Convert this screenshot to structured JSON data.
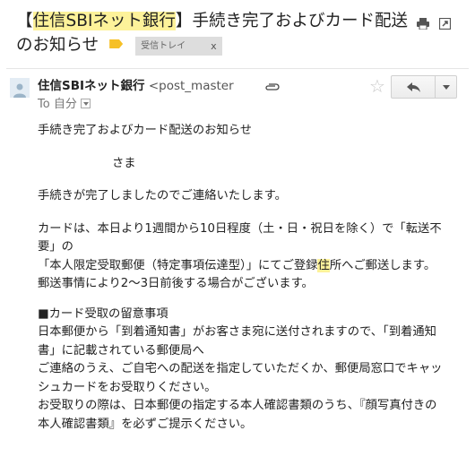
{
  "subject": {
    "open_bracket": "【",
    "bank_name": "住信SBIネット銀行",
    "close_bracket": "】",
    "line1_rest": "手続き完了およびカード配送",
    "line2": "のお知らせ",
    "label_text": "受信トレイ",
    "label_remove": "x"
  },
  "header": {
    "sender_name": "住信SBIネット銀行",
    "sender_email": "<post_master",
    "to_prefix": "To",
    "to_value": "自分",
    "star": "☆"
  },
  "body": {
    "line_title": "手続き完了およびカード配送のお知らせ",
    "line_sama": "さま",
    "line_complete": "手続きが完了しましたのでご連絡いたします。",
    "p2_a": "カードは、本日より1週間から10日程度（土・日・祝日を除く）で「転送不要」の",
    "p2_b1": "「本人限定受取郵便（特定事項伝達型）」にてご登録",
    "p2_b_hl": "住",
    "p2_b2": "所へご郵送します。",
    "p2_c": "郵送事情により2〜3日前後する場合がございます。",
    "section_title": "■カード受取の留意事項",
    "s1": "日本郵便から「到着通知書」がお客さま宛に送付されますので、「到着通知書」に記載されている郵便局へ",
    "s2": "ご連絡のうえ、ご自宅への配送を指定していただくか、郵便局窓口でキャッシュカードをお受取りください。",
    "s3": "お受取りの際は、日本郵便の指定する本人確認書類のうち、『顔写真付きの本人確認書類』を必ずご提示ください。"
  },
  "colors": {
    "highlight": "#fdf29a",
    "label_tag": "#f6c026",
    "label_bg": "#dddddd"
  },
  "icons": {
    "print": "print-icon",
    "popout": "new-window-icon",
    "avatar": "person-icon",
    "attachment": "paperclip-icon",
    "star": "star-icon",
    "reply": "reply-arrow-icon",
    "more": "chevron-down-icon",
    "label_tag": "label-tag-icon"
  }
}
